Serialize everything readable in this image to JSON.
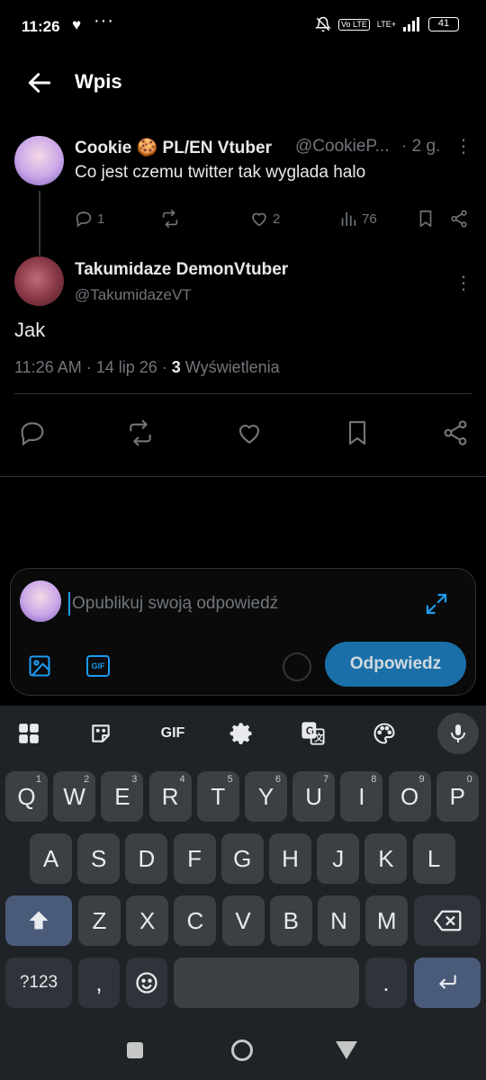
{
  "status_bar": {
    "time": "11:26",
    "heart": "♥",
    "dots": "···",
    "lte_label": "LTE+",
    "volte_label": "Vo LTE",
    "battery": "41"
  },
  "header": {
    "title": "Wpis"
  },
  "tweet1": {
    "name": "Cookie 🍪 PL/EN Vtuber",
    "handle": "@CookieP...",
    "time": "· 2 g.",
    "text": "Co jest czemu twitter tak wyglada halo",
    "replies": "1",
    "likes": "2",
    "views": "76"
  },
  "tweet2": {
    "name": "Takumidaze DemonVtuber",
    "handle": "@TakumidazeVT",
    "text": "Jak",
    "meta_prefix": "11:26 AM · 14 lip 26 · ",
    "views_count": "3",
    "views_label": " Wyświetlenia"
  },
  "reply": {
    "placeholder": "Opublikuj swoją odpowiedź",
    "gif_label": "GIF",
    "button_label": "Odpowiedz"
  },
  "keyboard": {
    "toolbar_gif": "GIF",
    "row1": [
      {
        "k": "Q",
        "n": "1"
      },
      {
        "k": "W",
        "n": "2"
      },
      {
        "k": "E",
        "n": "3"
      },
      {
        "k": "R",
        "n": "4"
      },
      {
        "k": "T",
        "n": "5"
      },
      {
        "k": "Y",
        "n": "6"
      },
      {
        "k": "U",
        "n": "7"
      },
      {
        "k": "I",
        "n": "8"
      },
      {
        "k": "O",
        "n": "9"
      },
      {
        "k": "P",
        "n": "0"
      }
    ],
    "row2": [
      "A",
      "S",
      "D",
      "F",
      "G",
      "H",
      "J",
      "K",
      "L"
    ],
    "row3": [
      "Z",
      "X",
      "C",
      "V",
      "B",
      "N",
      "M"
    ],
    "symbols_label": "?123",
    "comma": ",",
    "period": "."
  },
  "colors": {
    "accent": "#1d9bf0",
    "muted": "#71767b",
    "text": "#e7e9ea",
    "keyboard_bg": "#1f2226",
    "key_bg": "#3c4043"
  }
}
